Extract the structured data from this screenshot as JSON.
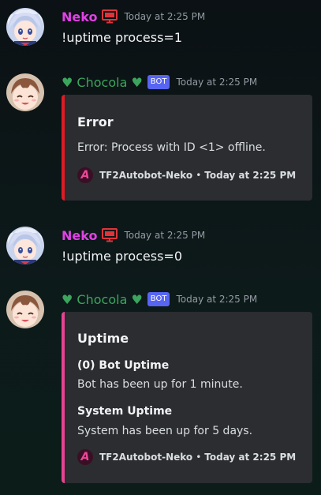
{
  "colors": {
    "neko_name": "#e141e6",
    "chocola_name": "#3ba55d",
    "bot_tag": "#5865f2",
    "error_bar": "#e01b24",
    "uptime_bar": "#e84393",
    "embed_bg": "#2b2d31"
  },
  "messages": [
    {
      "author": "Neko",
      "badge_icon": "monitor-icon",
      "timestamp": "Today at 2:25 PM",
      "text": "!uptime process=1"
    },
    {
      "author": "♥ Chocola ♥",
      "bot_tag": "BOT",
      "timestamp": "Today at 2:25 PM",
      "embed": {
        "title": "Error",
        "description": "Error: Process with ID <1> offline.",
        "footer_icon": "A",
        "footer_text": "TF2Autobot-Neko",
        "footer_separator": "•",
        "footer_time": "Today at 2:25 PM"
      }
    },
    {
      "author": "Neko",
      "badge_icon": "monitor-icon",
      "timestamp": "Today at 2:25 PM",
      "text": "!uptime process=0"
    },
    {
      "author": "♥ Chocola ♥",
      "bot_tag": "BOT",
      "timestamp": "Today at 2:25 PM",
      "embed": {
        "title": "Uptime",
        "fields": [
          {
            "name": "(0) Bot Uptime",
            "value": "Bot has been up for 1 minute."
          },
          {
            "name": "System Uptime",
            "value": "System has been up for 5 days."
          }
        ],
        "footer_icon": "A",
        "footer_text": "TF2Autobot-Neko",
        "footer_separator": "•",
        "footer_time": "Today at 2:25 PM"
      }
    }
  ]
}
